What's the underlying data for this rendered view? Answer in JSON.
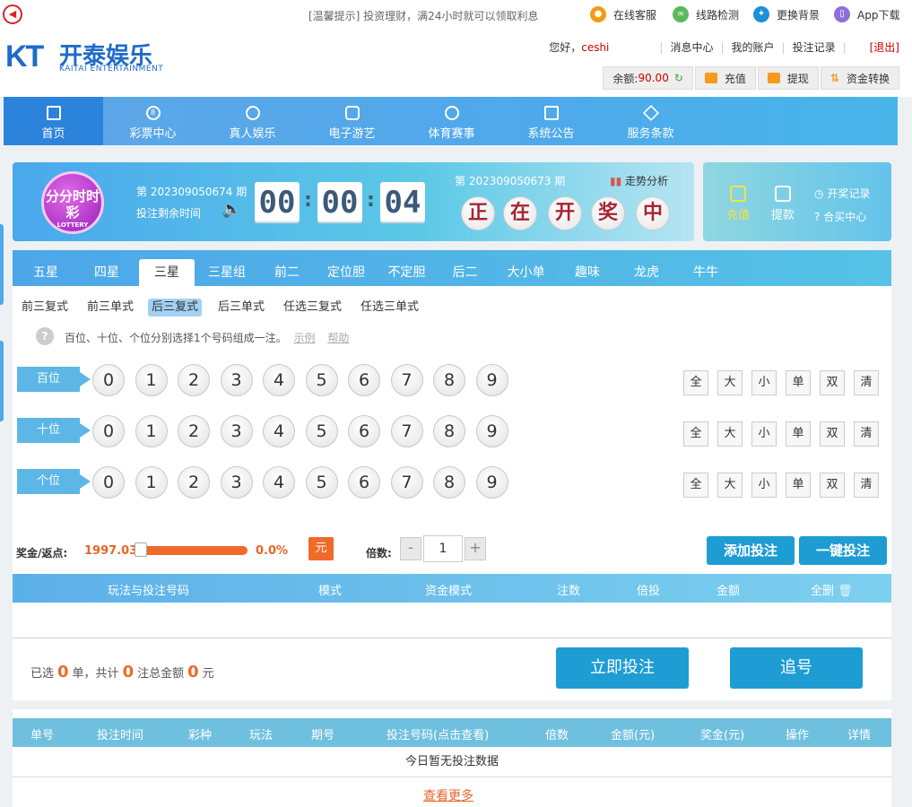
{
  "topbar": {
    "notice": "[温馨提示] 投资理财，满24小时就可以领取利息",
    "links": [
      {
        "label": "在线客服",
        "icon": "chat-icon",
        "color": "#f39c12"
      },
      {
        "label": "线路检测",
        "icon": "link-icon",
        "color": "#5cb85c"
      },
      {
        "label": "更换背景",
        "icon": "palette-icon",
        "color": "#1e8fd8"
      },
      {
        "label": "App下载",
        "icon": "phone-icon",
        "color": "#8e6fd8"
      }
    ]
  },
  "header": {
    "logo_mark": "KT",
    "logo_cn": "开泰娱乐",
    "logo_en": "KAITAI ENTERTAINMENT",
    "greeting": "您好，",
    "username": "ceshi",
    "links": [
      "消息中心",
      "我的账户",
      "投注记录"
    ],
    "logout": "[退出]",
    "balance_label": "余额:",
    "balance_value": "90.00",
    "recharge": "充值",
    "withdraw": "提现",
    "transfer": "资金转换"
  },
  "nav": {
    "items": [
      "首页",
      "彩票中心",
      "真人娱乐",
      "电子游艺",
      "体育赛事",
      "系统公告",
      "服务条款"
    ],
    "active_index": 0
  },
  "draw": {
    "lottery_logo_text": "分分时时彩",
    "lottery_logo_sub": "LOTTERY",
    "issue_text": "第 202309050674 期",
    "remain_label": "投注剩余时间",
    "countdown": [
      "00",
      "00",
      "04"
    ],
    "last_issue_prefix": "第",
    "last_issue": "202309050673",
    "last_issue_suffix": "期",
    "trend": "走势分析",
    "balls": [
      "正",
      "在",
      "开",
      "奖",
      "中"
    ]
  },
  "side": {
    "recharge": "充值",
    "withdraw": "提款",
    "draw_record": "开奖记录",
    "group_buy": "合买中心"
  },
  "play": {
    "tabs": [
      "五星",
      "四星",
      "三星",
      "三星组",
      "前二",
      "定位胆",
      "不定胆",
      "后二",
      "大小单",
      "趣味",
      "龙虎",
      "牛牛"
    ],
    "active_tab": 2,
    "subtabs": [
      "前三复式",
      "前三单式",
      "后三复式",
      "后三单式",
      "任选三复式",
      "任选三单式"
    ],
    "active_subtab": 2,
    "tip": "百位、十位、个位分别选择1个号码组成一注。",
    "example": "示例",
    "help": "帮助",
    "positions": [
      "百位",
      "十位",
      "个位"
    ],
    "numbers": [
      "0",
      "1",
      "2",
      "3",
      "4",
      "5",
      "6",
      "7",
      "8",
      "9"
    ],
    "quick": [
      "全",
      "大",
      "小",
      "单",
      "双",
      "清"
    ]
  },
  "bet": {
    "bonus_label": "奖金/返点:",
    "bonus_value": "1997.03",
    "rebate": "0.0%",
    "rebate_fraction": 0.0,
    "unit": "元",
    "multiplier_label": "倍数:",
    "minus": "-",
    "multiplier": "1",
    "plus": "+",
    "add_bet": "添加投注",
    "quick_bet": "一键投注"
  },
  "cart": {
    "headers": [
      "玩法与投注号码",
      "模式",
      "资金模式",
      "注数",
      "倍投",
      "金额",
      "全删"
    ],
    "selected_prefix": "已选",
    "selected_count": "0",
    "selected_unit": "单，共计",
    "bets_count": "0",
    "bets_unit": "注总金额",
    "total": "0",
    "total_unit": "元",
    "submit": "立即投注",
    "chase": "追号"
  },
  "records": {
    "headers": [
      "单号",
      "投注时间",
      "彩种",
      "玩法",
      "期号",
      "投注号码(点击查看)",
      "倍数",
      "金额(元)",
      "奖金(元)",
      "操作",
      "详情"
    ],
    "empty": "今日暂无投注数据",
    "more": "查看更多"
  }
}
